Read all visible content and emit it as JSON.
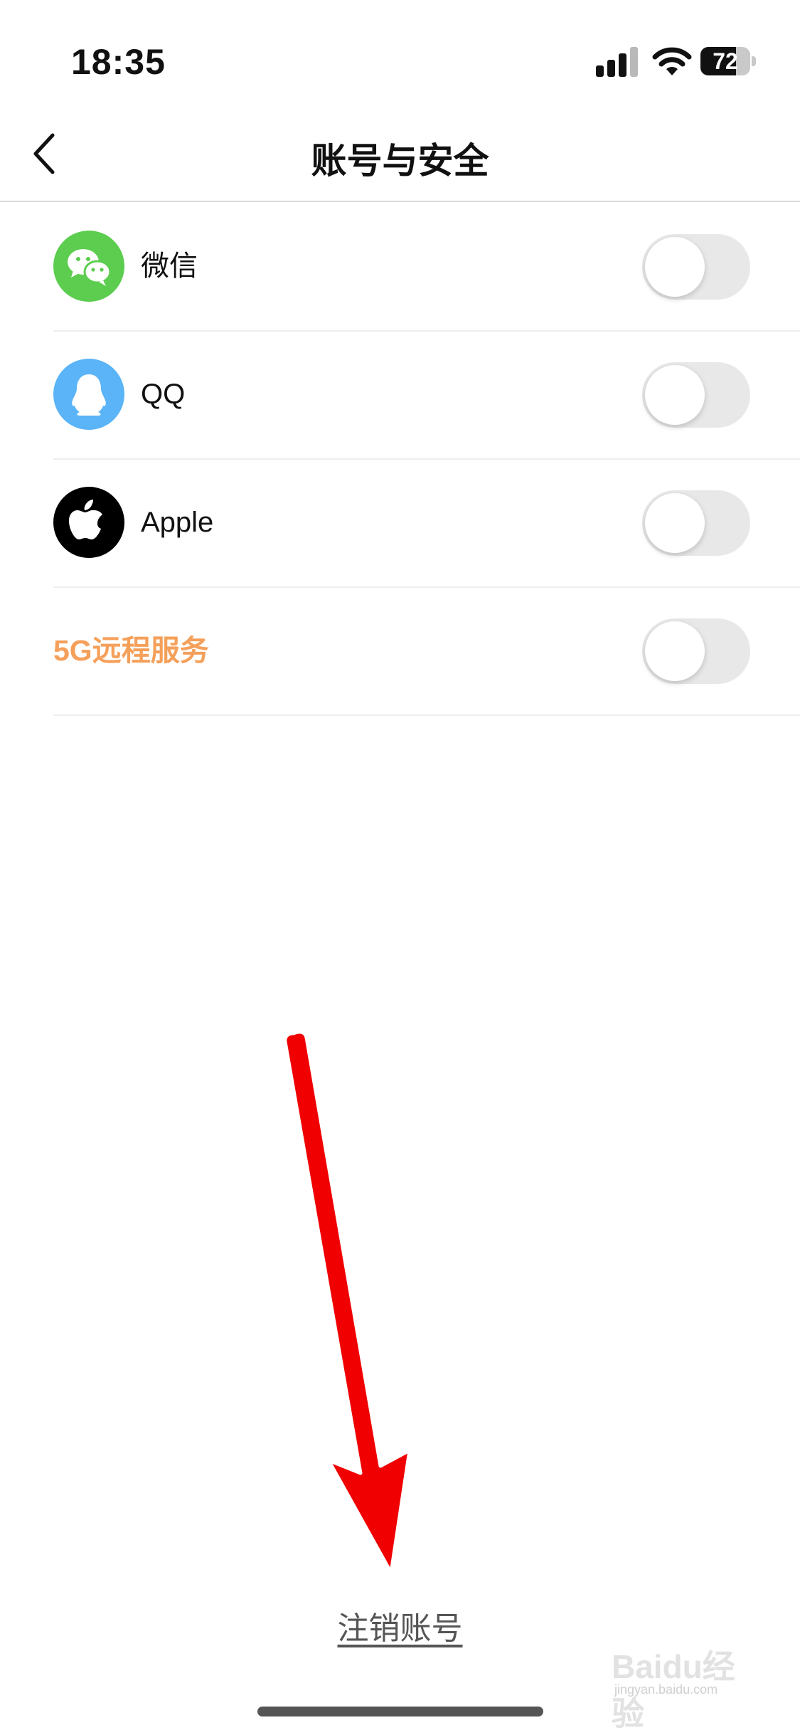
{
  "status": {
    "time": "18:35",
    "battery": "72",
    "battery_level": 0.72
  },
  "nav": {
    "title": "账号与安全",
    "back_icon": "chevron-left-icon"
  },
  "rows": [
    {
      "label": "微信",
      "icon": "wechat-icon",
      "icon_bg": "#5ccd4f",
      "enabled": false
    },
    {
      "label": "QQ",
      "icon": "qq-penguin-icon",
      "icon_bg": "#5ab4f7",
      "enabled": false
    },
    {
      "label": "Apple",
      "icon": "apple-icon",
      "icon_bg": "#000000",
      "enabled": false
    },
    {
      "label": "5G远程服务",
      "enabled": false
    }
  ],
  "footer": {
    "deregister": "注销账号"
  },
  "annotation": {
    "arrow_color": "#f00000"
  },
  "watermark": {
    "text": "Baidu经验",
    "sub": "jingyan.baidu.com"
  },
  "colors": {
    "promo": "#f5a05a",
    "toggle_off": "#e8e8e8"
  }
}
